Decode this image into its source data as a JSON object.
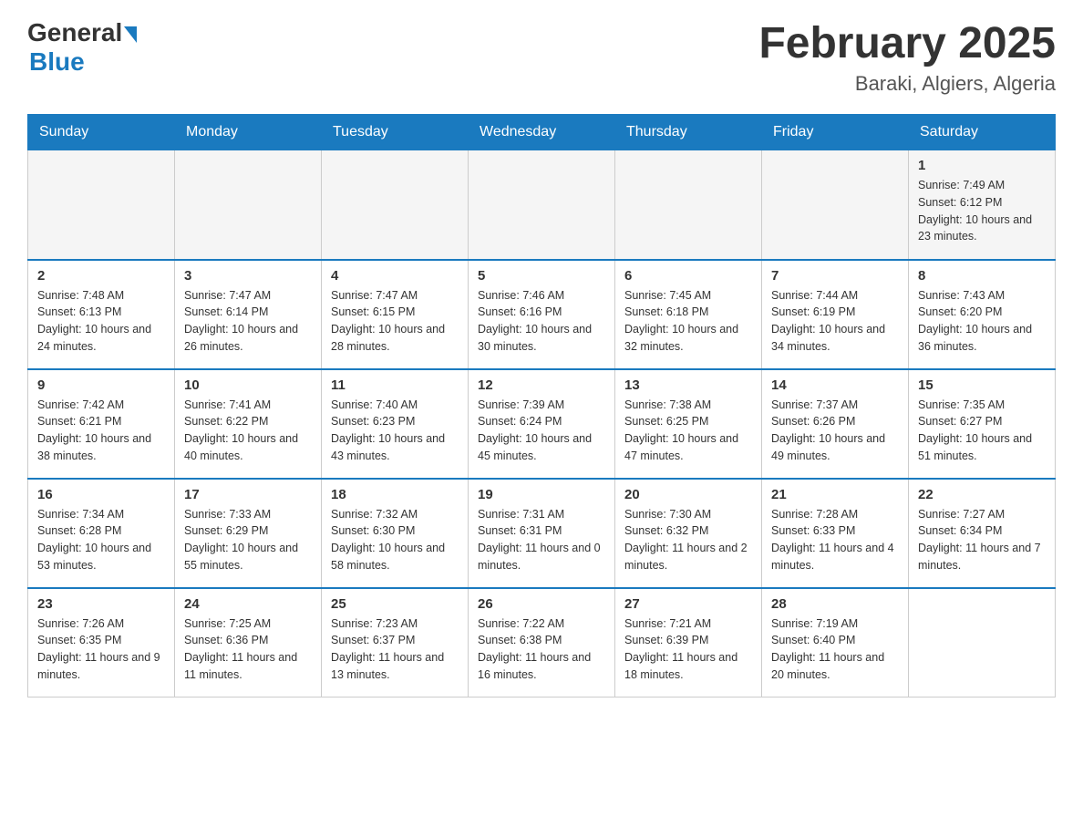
{
  "logo": {
    "general": "General",
    "blue": "Blue"
  },
  "header": {
    "title": "February 2025",
    "location": "Baraki, Algiers, Algeria"
  },
  "days_of_week": [
    "Sunday",
    "Monday",
    "Tuesday",
    "Wednesday",
    "Thursday",
    "Friday",
    "Saturday"
  ],
  "weeks": [
    [
      {
        "day": "",
        "info": ""
      },
      {
        "day": "",
        "info": ""
      },
      {
        "day": "",
        "info": ""
      },
      {
        "day": "",
        "info": ""
      },
      {
        "day": "",
        "info": ""
      },
      {
        "day": "",
        "info": ""
      },
      {
        "day": "1",
        "info": "Sunrise: 7:49 AM\nSunset: 6:12 PM\nDaylight: 10 hours and 23 minutes."
      }
    ],
    [
      {
        "day": "2",
        "info": "Sunrise: 7:48 AM\nSunset: 6:13 PM\nDaylight: 10 hours and 24 minutes."
      },
      {
        "day": "3",
        "info": "Sunrise: 7:47 AM\nSunset: 6:14 PM\nDaylight: 10 hours and 26 minutes."
      },
      {
        "day": "4",
        "info": "Sunrise: 7:47 AM\nSunset: 6:15 PM\nDaylight: 10 hours and 28 minutes."
      },
      {
        "day": "5",
        "info": "Sunrise: 7:46 AM\nSunset: 6:16 PM\nDaylight: 10 hours and 30 minutes."
      },
      {
        "day": "6",
        "info": "Sunrise: 7:45 AM\nSunset: 6:18 PM\nDaylight: 10 hours and 32 minutes."
      },
      {
        "day": "7",
        "info": "Sunrise: 7:44 AM\nSunset: 6:19 PM\nDaylight: 10 hours and 34 minutes."
      },
      {
        "day": "8",
        "info": "Sunrise: 7:43 AM\nSunset: 6:20 PM\nDaylight: 10 hours and 36 minutes."
      }
    ],
    [
      {
        "day": "9",
        "info": "Sunrise: 7:42 AM\nSunset: 6:21 PM\nDaylight: 10 hours and 38 minutes."
      },
      {
        "day": "10",
        "info": "Sunrise: 7:41 AM\nSunset: 6:22 PM\nDaylight: 10 hours and 40 minutes."
      },
      {
        "day": "11",
        "info": "Sunrise: 7:40 AM\nSunset: 6:23 PM\nDaylight: 10 hours and 43 minutes."
      },
      {
        "day": "12",
        "info": "Sunrise: 7:39 AM\nSunset: 6:24 PM\nDaylight: 10 hours and 45 minutes."
      },
      {
        "day": "13",
        "info": "Sunrise: 7:38 AM\nSunset: 6:25 PM\nDaylight: 10 hours and 47 minutes."
      },
      {
        "day": "14",
        "info": "Sunrise: 7:37 AM\nSunset: 6:26 PM\nDaylight: 10 hours and 49 minutes."
      },
      {
        "day": "15",
        "info": "Sunrise: 7:35 AM\nSunset: 6:27 PM\nDaylight: 10 hours and 51 minutes."
      }
    ],
    [
      {
        "day": "16",
        "info": "Sunrise: 7:34 AM\nSunset: 6:28 PM\nDaylight: 10 hours and 53 minutes."
      },
      {
        "day": "17",
        "info": "Sunrise: 7:33 AM\nSunset: 6:29 PM\nDaylight: 10 hours and 55 minutes."
      },
      {
        "day": "18",
        "info": "Sunrise: 7:32 AM\nSunset: 6:30 PM\nDaylight: 10 hours and 58 minutes."
      },
      {
        "day": "19",
        "info": "Sunrise: 7:31 AM\nSunset: 6:31 PM\nDaylight: 11 hours and 0 minutes."
      },
      {
        "day": "20",
        "info": "Sunrise: 7:30 AM\nSunset: 6:32 PM\nDaylight: 11 hours and 2 minutes."
      },
      {
        "day": "21",
        "info": "Sunrise: 7:28 AM\nSunset: 6:33 PM\nDaylight: 11 hours and 4 minutes."
      },
      {
        "day": "22",
        "info": "Sunrise: 7:27 AM\nSunset: 6:34 PM\nDaylight: 11 hours and 7 minutes."
      }
    ],
    [
      {
        "day": "23",
        "info": "Sunrise: 7:26 AM\nSunset: 6:35 PM\nDaylight: 11 hours and 9 minutes."
      },
      {
        "day": "24",
        "info": "Sunrise: 7:25 AM\nSunset: 6:36 PM\nDaylight: 11 hours and 11 minutes."
      },
      {
        "day": "25",
        "info": "Sunrise: 7:23 AM\nSunset: 6:37 PM\nDaylight: 11 hours and 13 minutes."
      },
      {
        "day": "26",
        "info": "Sunrise: 7:22 AM\nSunset: 6:38 PM\nDaylight: 11 hours and 16 minutes."
      },
      {
        "day": "27",
        "info": "Sunrise: 7:21 AM\nSunset: 6:39 PM\nDaylight: 11 hours and 18 minutes."
      },
      {
        "day": "28",
        "info": "Sunrise: 7:19 AM\nSunset: 6:40 PM\nDaylight: 11 hours and 20 minutes."
      },
      {
        "day": "",
        "info": ""
      }
    ]
  ]
}
